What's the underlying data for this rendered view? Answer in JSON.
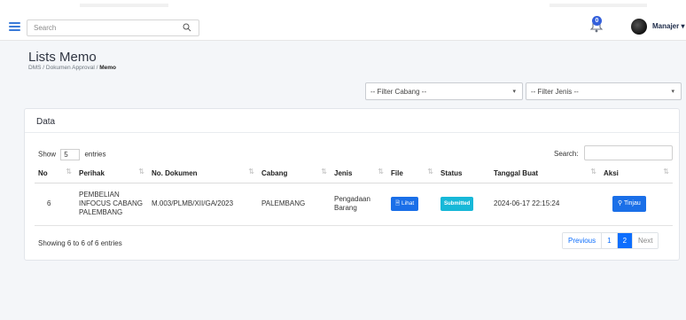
{
  "header": {
    "search_placeholder": "Search",
    "notification_count": "0",
    "user_name": "Manajer ▾"
  },
  "page": {
    "title": "Lists Memo",
    "breadcrumb": [
      "DMS",
      "Dokumen Approval",
      "Memo"
    ]
  },
  "filters": {
    "cabang": "-- Filter Cabang --",
    "jenis": "-- Filter Jenis --"
  },
  "card": {
    "title": "Data",
    "show_label": "Show",
    "entries_value": "5",
    "entries_label": "entries",
    "search_label": "Search:",
    "columns": [
      "No",
      "Perihak",
      "No. Dokumen",
      "Cabang",
      "Jenis",
      "File",
      "Status",
      "Tanggal Buat",
      "Aksi"
    ],
    "rows": [
      {
        "no": "6",
        "perihak": "PEMBELIAN INFOCUS CABANG PALEMBANG",
        "no_dokumen": "M.003/PLMB/XII/GA/2023",
        "cabang": "PALEMBANG",
        "jenis": "Pengadaan Barang",
        "file_label": "Lihat",
        "status": "Submitted",
        "tanggal": "2024-06-17 22:15:24",
        "aksi_label": "Tinjau"
      }
    ],
    "showing": "Showing 6 to 6 of 6 entries",
    "pagination": [
      "Previous",
      "1",
      "2",
      "Next"
    ]
  },
  "colors": {
    "primary": "#1a6fe8",
    "status_badge": "#17b8d8"
  }
}
